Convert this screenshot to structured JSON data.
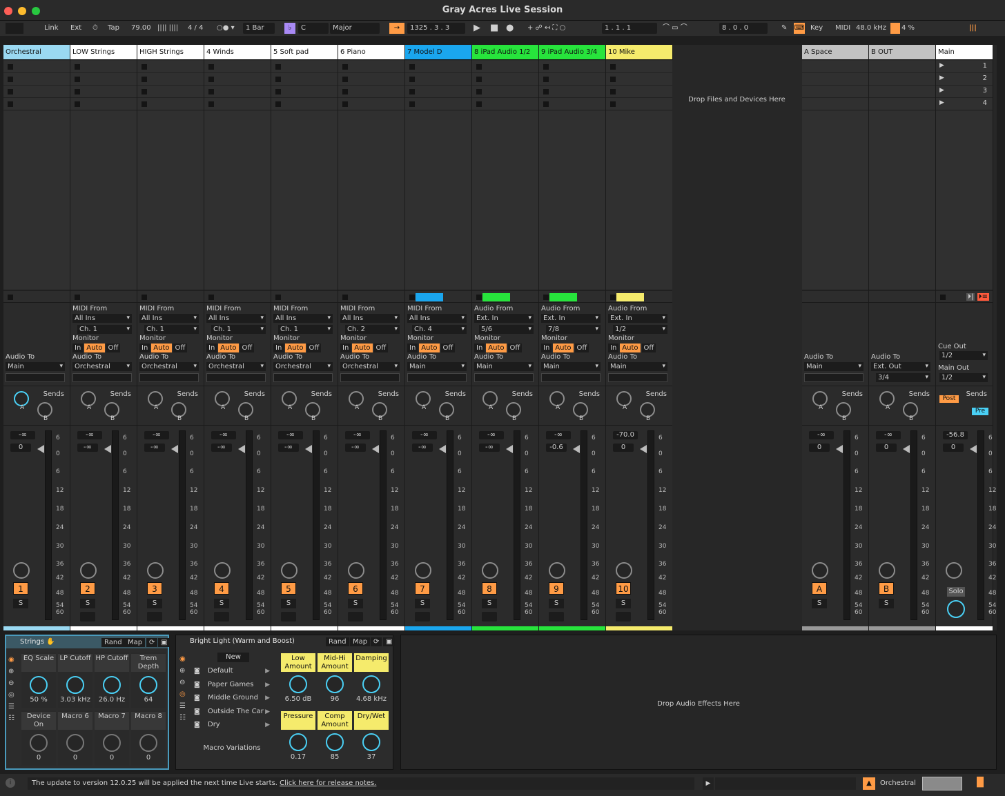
{
  "title": "Gray Acres Live Session",
  "controlbar": {
    "link": "Link",
    "ext": "Ext",
    "tap": "Tap",
    "tempo": "79.00",
    "sig": "4 / 4",
    "quant": "1 Bar",
    "key_root": "C",
    "scale": "Major",
    "position": "1325 .  3 .  3",
    "loop_start": "1 .  1 .  1",
    "loop_len": "8 .  0 .  0",
    "key": "Key",
    "midi": "MIDI",
    "sample_rate": "48.0 kHz",
    "cpu": "4 %"
  },
  "drop_files": "Drop Files and Devices Here",
  "drop_effects": "Drop Audio Effects Here",
  "scenes": [
    "1",
    "2",
    "3",
    "4"
  ],
  "main_label": "Main",
  "main": {
    "cue_out_label": "Cue Out",
    "cue_out": "1/2",
    "main_out_label": "Main Out",
    "main_out": "1/2",
    "post": "Post",
    "pre": "Pre",
    "vol": "-56.8",
    "pan": "0",
    "solo": "Solo",
    "sends": "Sends"
  },
  "labels": {
    "midi_from": "MIDI From",
    "audio_from": "Audio From",
    "monitor": "Monitor",
    "audio_to": "Audio To",
    "sends": "Sends",
    "in": "In",
    "auto": "Auto",
    "off": "Off",
    "s": "S",
    "a": "A",
    "b": "B"
  },
  "scale_marks": [
    "6",
    "0",
    "6",
    "12",
    "18",
    "24",
    "30",
    "36",
    "42",
    "48",
    "54",
    "60"
  ],
  "tracks": [
    {
      "name": "Orchestral",
      "kind": "group",
      "color": "#9ad9f2",
      "num": "1",
      "audio_to": "Main",
      "vol": "-∞",
      "pan": "0"
    },
    {
      "name": "LOW Strings",
      "kind": "midi",
      "color": "#ffffff",
      "num": "2",
      "from": "All Ins",
      "ch": "Ch. 1",
      "audio_to": "Orchestral",
      "vol": "-∞",
      "pan": "-∞"
    },
    {
      "name": "HIGH Strings",
      "kind": "midi",
      "color": "#ffffff",
      "num": "3",
      "from": "All Ins",
      "ch": "Ch. 1",
      "audio_to": "Orchestral",
      "vol": "-∞",
      "pan": "-∞"
    },
    {
      "name": "4 Winds",
      "kind": "midi",
      "color": "#ffffff",
      "num": "4",
      "from": "All Ins",
      "ch": "Ch. 1",
      "audio_to": "Orchestral",
      "vol": "-∞",
      "pan": "-∞"
    },
    {
      "name": "5 Soft pad",
      "kind": "midi",
      "color": "#ffffff",
      "num": "5",
      "from": "All Ins",
      "ch": "Ch. 1",
      "audio_to": "Orchestral",
      "vol": "-∞",
      "pan": "-∞"
    },
    {
      "name": "6 Piano",
      "kind": "midi",
      "color": "#ffffff",
      "num": "6",
      "from": "All Ins",
      "ch": "Ch. 2",
      "audio_to": "Orchestral",
      "vol": "-∞",
      "pan": "-∞"
    },
    {
      "name": "7 Model D",
      "kind": "midi",
      "color": "#1aa6ee",
      "num": "7",
      "from": "All Ins",
      "ch": "Ch. 4",
      "audio_to": "Main",
      "vol": "-∞",
      "pan": "-∞"
    },
    {
      "name": "8 iPad Audio 1/2",
      "kind": "audio",
      "color": "#27e43c",
      "num": "8",
      "from": "Ext. In",
      "ch": "5/6",
      "audio_to": "Main",
      "vol": "-∞",
      "pan": "-∞"
    },
    {
      "name": "9 iPad Audio 3/4",
      "kind": "audio",
      "color": "#27e43c",
      "num": "9",
      "from": "Ext. In",
      "ch": "7/8",
      "audio_to": "Main",
      "vol": "-∞",
      "pan": "-0.6"
    },
    {
      "name": "10 Mike",
      "kind": "audio",
      "color": "#f5eb6c",
      "num": "10",
      "from": "Ext. In",
      "ch": "1/2",
      "audio_to": "Main",
      "vol": "-70.0",
      "pan": "0"
    }
  ],
  "returns": [
    {
      "name": "A Space",
      "num": "A",
      "audio_to": "Main",
      "vol": "-∞",
      "pan": "0"
    },
    {
      "name": "B OUT",
      "num": "B",
      "audio_to": "Ext. Out",
      "ch": "3/4",
      "vol": "-∞",
      "pan": "0"
    }
  ],
  "rack1": {
    "title": "Strings",
    "rand": "Rand",
    "map": "Map",
    "macros": [
      {
        "label": "EQ Scale",
        "value": "50 %"
      },
      {
        "label": "LP Cutoff",
        "value": "3.03 kHz"
      },
      {
        "label": "HP Cutoff",
        "value": "26.0 Hz"
      },
      {
        "label": "Trem Depth",
        "value": "64"
      },
      {
        "label": "Device On",
        "value": "0"
      },
      {
        "label": "Macro 6",
        "value": "0"
      },
      {
        "label": "Macro 7",
        "value": "0"
      },
      {
        "label": "Macro 8",
        "value": "0"
      }
    ]
  },
  "rack2": {
    "title": "Bright Light (Warm and Boost)",
    "rand": "Rand",
    "map": "Map",
    "new": "New",
    "variations": [
      "Default",
      "Paper Games",
      "Middle Ground",
      "Outside The Car",
      "Dry"
    ],
    "variations_label": "Macro Variations",
    "macros": [
      {
        "label": "Low Amount",
        "value": "6.50 dB"
      },
      {
        "label": "Mid-Hi Amount",
        "value": "96"
      },
      {
        "label": "Damping",
        "value": "4.68 kHz"
      },
      {
        "label": "Pressure",
        "value": "0.17"
      },
      {
        "label": "Comp Amount",
        "value": "85"
      },
      {
        "label": "Dry/Wet",
        "value": "37"
      }
    ]
  },
  "status": {
    "message": "The update to version 12.0.25 will be applied the next time Live starts.",
    "link": "Click here for release notes.",
    "selected_track": "Orchestral"
  }
}
